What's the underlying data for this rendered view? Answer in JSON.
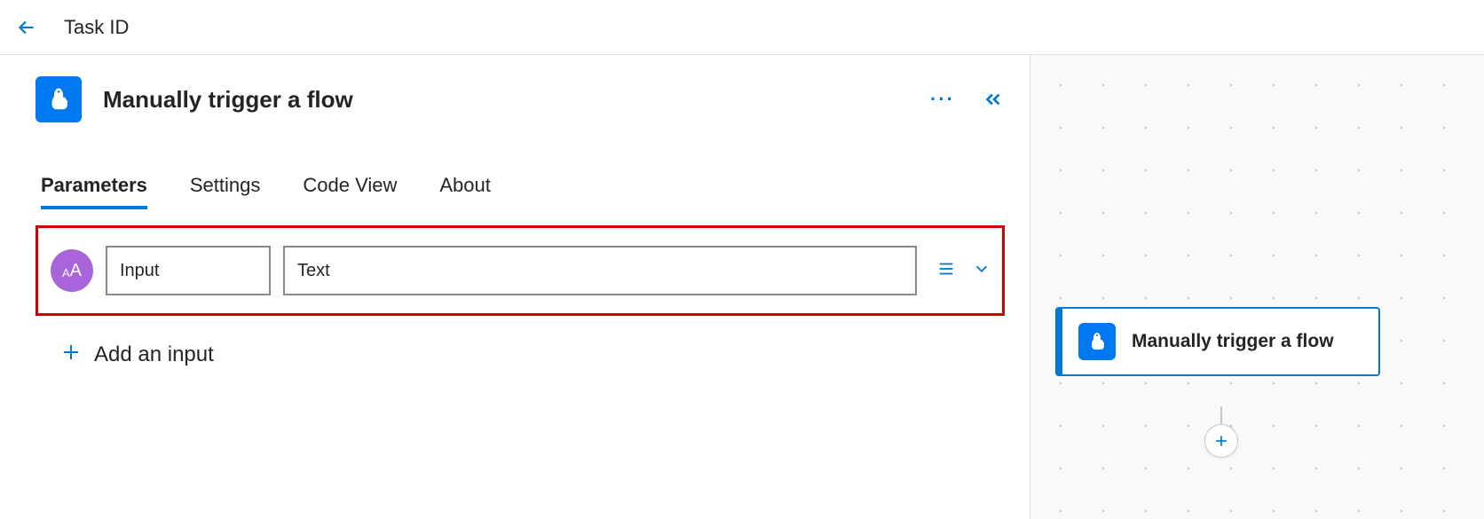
{
  "header": {
    "title": "Task ID"
  },
  "panel": {
    "title": "Manually trigger a flow",
    "tabs": [
      {
        "label": "Parameters",
        "active": true
      },
      {
        "label": "Settings",
        "active": false
      },
      {
        "label": "Code View",
        "active": false
      },
      {
        "label": "About",
        "active": false
      }
    ],
    "input_row": {
      "badge_text": "AA",
      "name": "Input",
      "value": "Text"
    },
    "add_input_label": "Add an input"
  },
  "canvas": {
    "card_title": "Manually trigger a flow"
  }
}
